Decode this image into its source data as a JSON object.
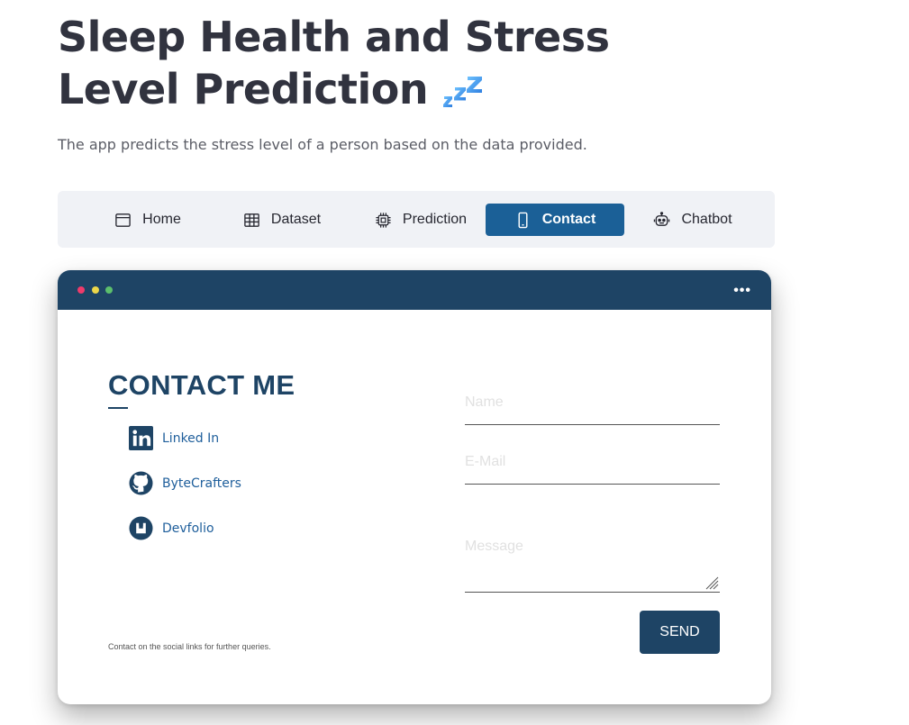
{
  "page": {
    "title": "Sleep Health and Stress Level Prediction",
    "title_icon": "zzz-icon",
    "subtitle": "The app predicts the stress level of a person based on the data provided."
  },
  "nav": {
    "items": [
      {
        "label": "Home",
        "icon": "window-icon"
      },
      {
        "label": "Dataset",
        "icon": "table-icon"
      },
      {
        "label": "Prediction",
        "icon": "cpu-icon"
      },
      {
        "label": "Contact",
        "icon": "phone-icon"
      },
      {
        "label": "Chatbot",
        "icon": "robot-icon"
      }
    ],
    "active_label": "Contact"
  },
  "window": {
    "menu": "•••",
    "contact_title": "CONTACT ME",
    "socials": [
      {
        "label": "Linked In",
        "icon": "linkedin-icon"
      },
      {
        "label": "ByteCrafters",
        "icon": "github-icon"
      },
      {
        "label": "Devfolio",
        "icon": "devfolio-icon"
      }
    ],
    "footer_note": "Contact on the social links for further queries.",
    "form": {
      "name_placeholder": "Name",
      "email_placeholder": "E-Mail",
      "message_placeholder": "Message",
      "send_label": "SEND"
    }
  },
  "colors": {
    "accent": "#1b6097",
    "window_bar": "#1e4465",
    "nav_bg": "#f0f2f6",
    "link": "#1e5e9b"
  }
}
